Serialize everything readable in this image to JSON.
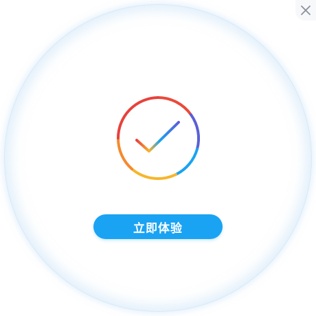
{
  "dialog": {
    "close_icon": "close-icon",
    "status_icon": "check-circle-icon",
    "cta_label": "立即体验"
  },
  "colors": {
    "cta_background": "#1aa3f2",
    "cta_text": "#ffffff",
    "panel_border": "#d6eaf9",
    "close_icon": "#8a9099",
    "ring_gradient": [
      "#e8413c",
      "#f7b52b",
      "#1aa3f2",
      "#5a5fd6"
    ],
    "check_gradient": [
      "#e8413c",
      "#f7b52b",
      "#1aa3f2",
      "#5a5fd6"
    ]
  }
}
